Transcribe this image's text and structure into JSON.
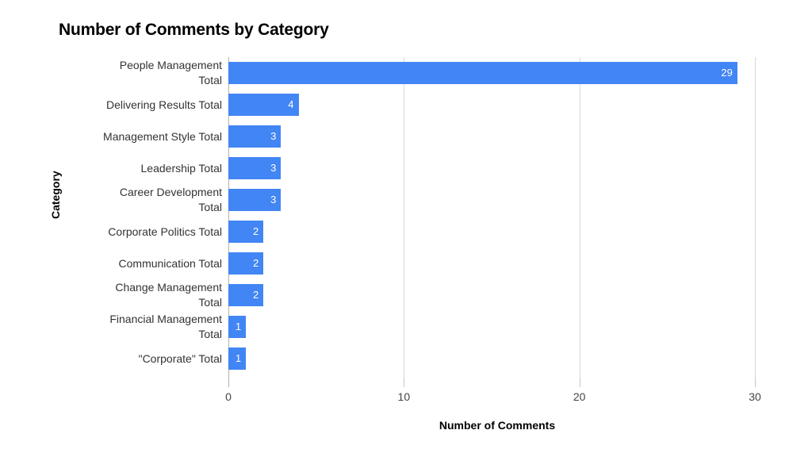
{
  "chart_data": {
    "type": "bar",
    "orientation": "horizontal",
    "title": "Number of Comments by Category",
    "xlabel": "Number of Comments",
    "ylabel": "Category",
    "categories": [
      "People Management Total",
      "Delivering Results Total",
      "Management Style Total",
      "Leadership Total",
      "Career Development Total",
      "Corporate Politics Total",
      "Communication Total",
      "Change Management Total",
      "Financial Management Total",
      "\"Corporate\" Total"
    ],
    "category_labels_wrapped": [
      "People Management\nTotal",
      "Delivering Results Total",
      "Management Style Total",
      "Leadership Total",
      "Career Development\nTotal",
      "Corporate Politics Total",
      "Communication Total",
      "Change Management\nTotal",
      "Financial Management\nTotal",
      "\"Corporate\" Total"
    ],
    "values": [
      29,
      4,
      3,
      3,
      3,
      2,
      2,
      2,
      1,
      1
    ],
    "value_labels": [
      "29",
      "4",
      "3",
      "3",
      "3",
      "2",
      "2",
      "2",
      "1",
      "1"
    ],
    "xlim": [
      0,
      30
    ],
    "xticks": [
      0,
      10,
      20,
      30
    ],
    "xtick_labels": [
      "0",
      "10",
      "20",
      "30"
    ],
    "grid": true,
    "grid_axis": "x",
    "legend": false,
    "bar_color": "#4285f4",
    "value_label_color": "#ffffff",
    "gridline_color": "#d9d9d9",
    "axis_line_color": "#b7b0a8",
    "background_color": "#ffffff",
    "title_color": "#000000",
    "tick_label_color": "#444444",
    "category_label_color": "#333333"
  }
}
